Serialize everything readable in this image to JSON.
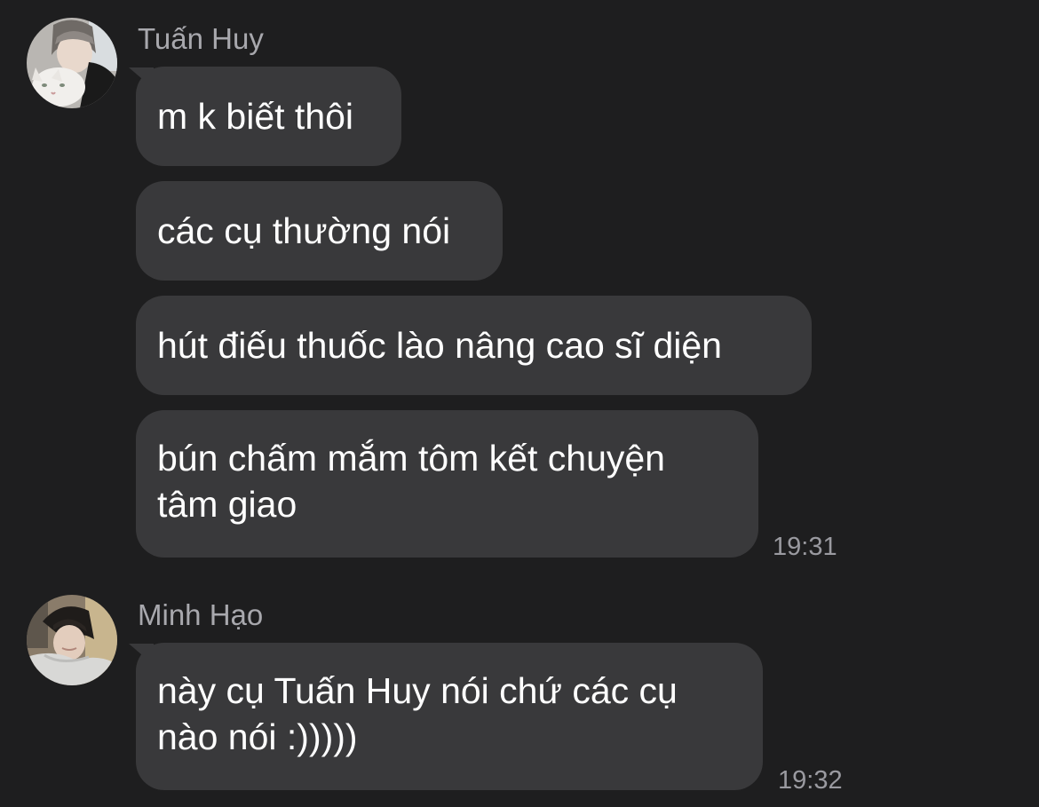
{
  "groups": [
    {
      "sender": "Tuấn Huy",
      "avatar_icon": "profile-photo-with-cat",
      "messages": [
        {
          "lines": [
            "m k biết thôi"
          ]
        },
        {
          "lines": [
            "các cụ thường nói"
          ]
        },
        {
          "lines": [
            "hút điếu thuốc lào nâng cao sĩ diện"
          ]
        },
        {
          "lines": [
            "bún chấm mắm tôm kết chuyện",
            "tâm giao"
          ],
          "time": "19:31"
        }
      ]
    },
    {
      "sender": "Minh Hạo",
      "avatar_icon": "profile-photo-hooded",
      "messages": [
        {
          "lines": [
            "này cụ Tuấn Huy nói chứ các cụ",
            "nào nói :)))))"
          ],
          "time": "19:32"
        }
      ]
    }
  ],
  "colors": {
    "background": "#1e1e1f",
    "bubble": "#39393b",
    "sender_name": "#a8a8ad",
    "timestamp": "#9a9aa0",
    "message_text": "#ffffff"
  }
}
